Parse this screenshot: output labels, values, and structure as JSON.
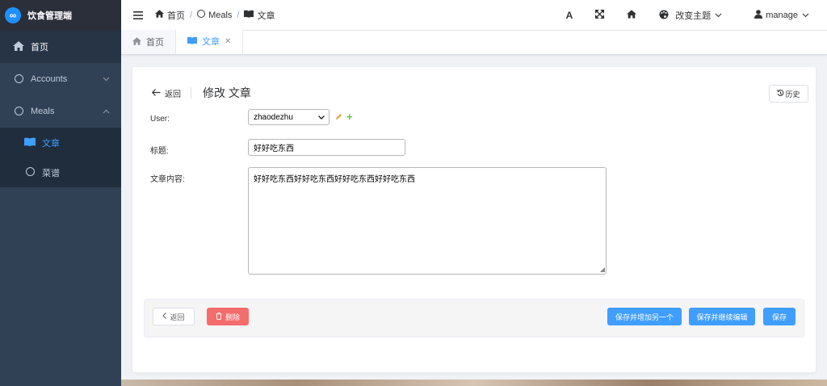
{
  "app": {
    "name": "饮食管理端",
    "logo_glyph": "∞"
  },
  "sidebar": {
    "items": [
      {
        "label": "首页",
        "icon": "home-icon"
      },
      {
        "label": "Accounts",
        "icon": "circle-icon"
      },
      {
        "label": "Meals",
        "icon": "circle-icon"
      }
    ],
    "sub_items": [
      {
        "label": "文章",
        "icon": "book-icon",
        "active": true
      },
      {
        "label": "菜谱",
        "icon": "circle-icon"
      }
    ]
  },
  "topbar": {
    "breadcrumb": [
      "首页",
      "Meals",
      "文章"
    ],
    "font_btn": "A",
    "theme_label": "改变主题",
    "user_label": "manage"
  },
  "tags": [
    {
      "label": "首页",
      "icon": "home-icon",
      "active": false
    },
    {
      "label": "文章",
      "icon": "book-icon",
      "active": true
    }
  ],
  "page": {
    "back_label": "返回",
    "title": "修改 文章",
    "history_label": "历史"
  },
  "form": {
    "user_label": "User:",
    "user_value": "zhaodezhu",
    "title_label": "标题:",
    "title_value": "好好吃东西",
    "content_label": "文章内容:",
    "content_value": "好好吃东西好好吃东西好好吃东西好好吃东西"
  },
  "actions": {
    "back": "返回",
    "delete": "删除",
    "save_add_another": "保存并增加另一个",
    "save_continue": "保存并继续编辑",
    "save": "保存"
  },
  "colors": {
    "accent": "#409eff",
    "danger": "#f56c6c",
    "sidebar": "#304156"
  }
}
